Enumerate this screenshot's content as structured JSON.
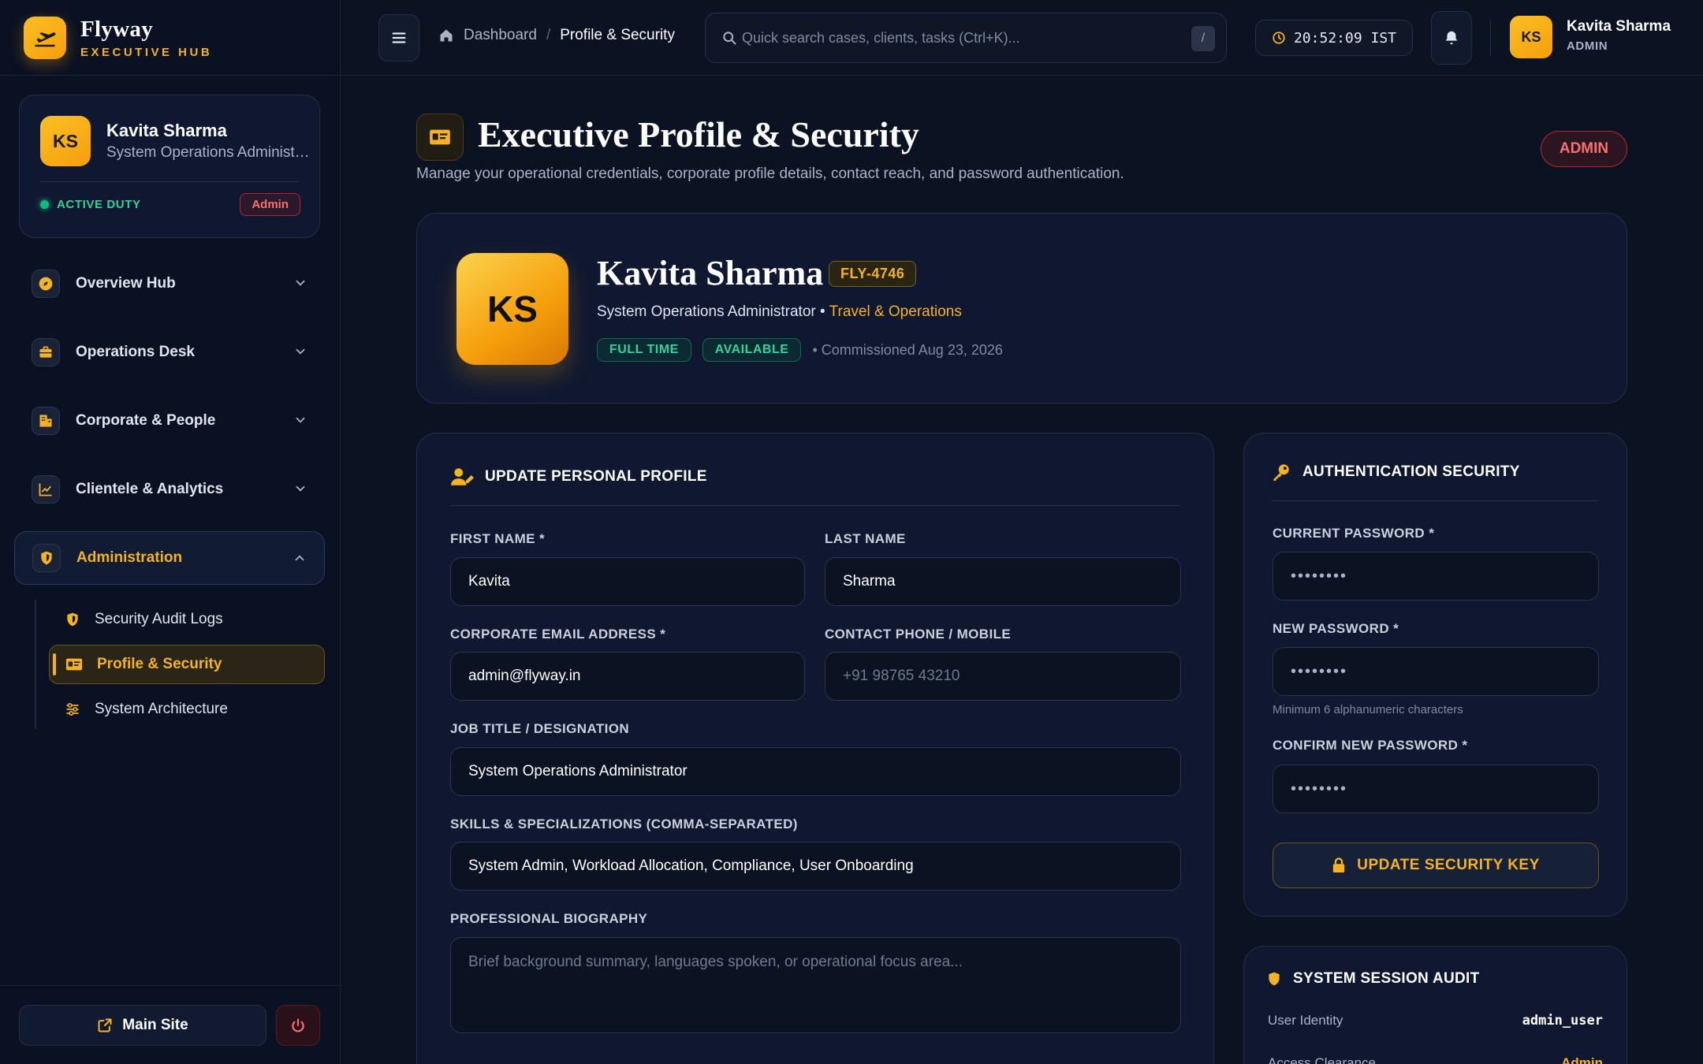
{
  "brand": {
    "name": "Flyway",
    "subtitle": "EXECUTIVE HUB",
    "accent": "#f5b324"
  },
  "sidebar": {
    "profile": {
      "initials": "KS",
      "name": "Kavita Sharma",
      "role": "System Operations Administrator",
      "duty": "ACTIVE DUTY",
      "badge": "Admin"
    },
    "items": [
      {
        "label": "Overview Hub",
        "icon": "compass-icon"
      },
      {
        "label": "Operations Desk",
        "icon": "briefcase-icon"
      },
      {
        "label": "Corporate & People",
        "icon": "building-icon"
      },
      {
        "label": "Clientele & Analytics",
        "icon": "chart-line-icon"
      },
      {
        "label": "Administration",
        "icon": "shield-icon"
      }
    ],
    "sub_items": [
      {
        "label": "Security Audit Logs",
        "icon": "shield-icon"
      },
      {
        "label": "Profile & Security",
        "icon": "id-card-icon"
      },
      {
        "label": "System Architecture",
        "icon": "sliders-icon"
      }
    ],
    "footer": {
      "main_site": "Main Site"
    }
  },
  "topbar": {
    "breadcrumb": {
      "home": "Dashboard",
      "current": "Profile & Security"
    },
    "search": {
      "placeholder": "Quick search cases, clients, tasks (Ctrl+K)...",
      "shortcut": "/"
    },
    "clock": "20:52:09 IST",
    "user": {
      "initials": "KS",
      "name": "Kavita Sharma",
      "role": "ADMIN"
    }
  },
  "page": {
    "title": "Executive Profile & Security",
    "description": "Manage your operational credentials, corporate profile details, contact reach, and password authentication.",
    "role_pill": "ADMIN"
  },
  "hero": {
    "initials": "KS",
    "name": "Kavita Sharma",
    "id": "FLY-4746",
    "role": "System Operations Administrator",
    "separator": "•",
    "department": "Travel & Operations",
    "tags": [
      "FULL TIME",
      "AVAILABLE"
    ],
    "commissioned": "• Commissioned Aug 23, 2026"
  },
  "profile_form": {
    "heading": "UPDATE PERSONAL PROFILE",
    "first_name": {
      "label": "FIRST NAME *",
      "value": "Kavita"
    },
    "last_name": {
      "label": "LAST NAME",
      "value": "Sharma"
    },
    "email": {
      "label": "CORPORATE EMAIL ADDRESS *",
      "value": "admin@flyway.in"
    },
    "phone": {
      "label": "CONTACT PHONE / MOBILE",
      "placeholder": "+91 98765 43210"
    },
    "job_title": {
      "label": "JOB TITLE / DESIGNATION",
      "value": "System Operations Administrator"
    },
    "skills": {
      "label": "SKILLS & SPECIALIZATIONS (COMMA-SEPARATED)",
      "value": "System Admin, Workload Allocation, Compliance, User Onboarding"
    },
    "bio": {
      "label": "PROFESSIONAL BIOGRAPHY",
      "placeholder": "Brief background summary, languages spoken, or operational focus area..."
    }
  },
  "auth": {
    "heading": "AUTHENTICATION SECURITY",
    "current": {
      "label": "CURRENT PASSWORD *",
      "mask": "••••••••"
    },
    "new": {
      "label": "NEW PASSWORD *",
      "mask": "••••••••",
      "hint": "Minimum 6 alphanumeric characters"
    },
    "confirm": {
      "label": "CONFIRM NEW PASSWORD *",
      "mask": "••••••••"
    },
    "button": "UPDATE SECURITY KEY"
  },
  "session": {
    "heading": "SYSTEM SESSION AUDIT",
    "rows": [
      {
        "key": "User Identity",
        "value": "admin_user"
      },
      {
        "key": "Access Clearance",
        "value": "Admin"
      }
    ]
  }
}
